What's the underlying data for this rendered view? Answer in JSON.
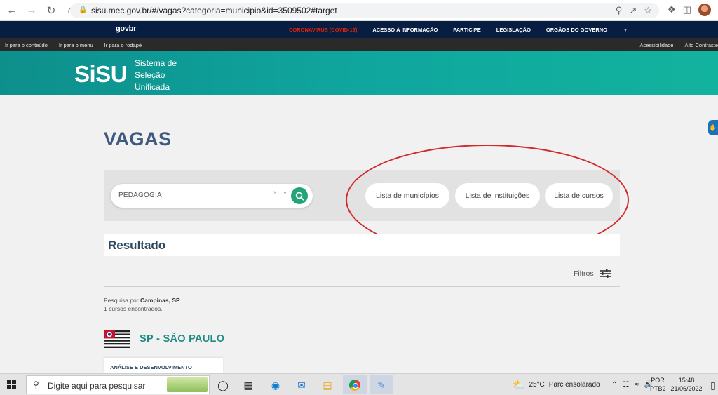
{
  "browser": {
    "url": "sisu.mec.gov.br/#/vagas?categoria=municipio&id=3509502#target"
  },
  "gov_bar": {
    "logo": "govbr",
    "links": [
      "CORONAVÍRUS (COVID-19)",
      "ACESSO À INFORMAÇÃO",
      "PARTICIPE",
      "LEGISLAÇÃO",
      "ÓRGÃOS DO GOVERNO"
    ]
  },
  "access_bar": {
    "left": [
      "Ir para o conteúdo",
      "Ir para o menu",
      "Ir para o rodapé"
    ],
    "right": [
      "Acessibilidade",
      "Alto Contraste"
    ]
  },
  "header": {
    "logo": "SiSU",
    "subtitle": [
      "Sistema de",
      "Seleção",
      "Unificada"
    ]
  },
  "page": {
    "title": "VAGAS",
    "search_value": "PEDAGOGIA",
    "buttons": {
      "municipios": "Lista de municípios",
      "instituicoes": "Lista de instituições",
      "cursos": "Lista de cursos"
    },
    "result_title": "Resultado",
    "filters_label": "Filtros",
    "search_prefix": "Pesquisa por",
    "search_place": "Campinas, SP",
    "count_text": "1 cursos encontrados.",
    "state_name": "SP - SÃO PAULO",
    "course_title": "ANÁLISE E DESENVOLVIMENTO"
  },
  "taskbar": {
    "search_placeholder": "Digite aqui para pesquisar",
    "weather": "25°C",
    "weather_desc": "Parc ensolarado",
    "lang_top": "POR",
    "lang_bottom": "PTB2",
    "time": "15:48",
    "date": "21/06/2022"
  },
  "colors": {
    "gov_bar": "#071d41",
    "header_teal": "#0fa69e",
    "search_green": "#23a37a",
    "annotation_red": "#d22a2a"
  }
}
